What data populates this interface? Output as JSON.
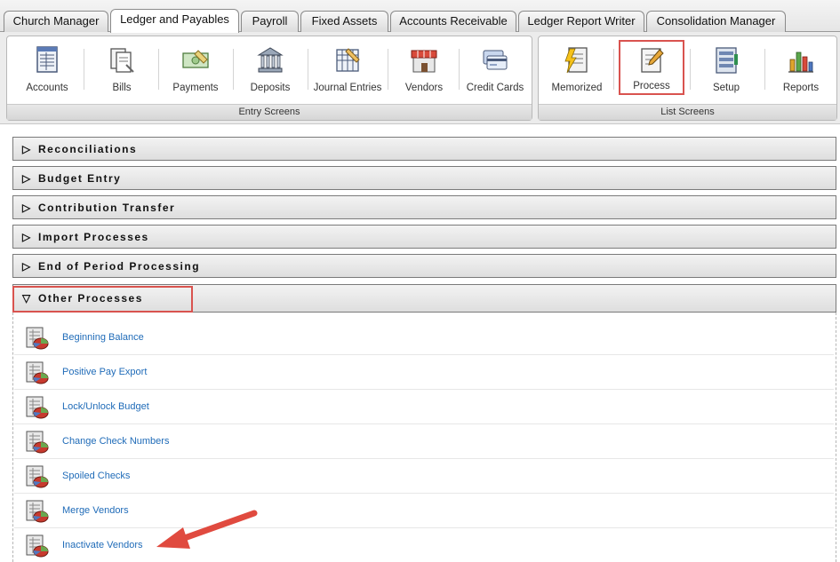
{
  "tabs": [
    {
      "label": "Church Manager"
    },
    {
      "label": "Ledger and Payables"
    },
    {
      "label": "Payroll"
    },
    {
      "label": "Fixed Assets"
    },
    {
      "label": "Accounts Receivable"
    },
    {
      "label": "Ledger Report Writer"
    },
    {
      "label": "Consolidation Manager"
    }
  ],
  "entry_screens": {
    "caption": "Entry Screens",
    "items": [
      {
        "label": "Accounts",
        "icon": "accounts-icon"
      },
      {
        "label": "Bills",
        "icon": "bills-icon"
      },
      {
        "label": "Payments",
        "icon": "payments-icon"
      },
      {
        "label": "Deposits",
        "icon": "bank-icon"
      },
      {
        "label": "Journal Entries",
        "icon": "journal-icon"
      },
      {
        "label": "Vendors",
        "icon": "store-icon"
      },
      {
        "label": "Credit Cards",
        "icon": "credit-card-icon"
      }
    ]
  },
  "list_screens": {
    "caption": "List Screens",
    "items": [
      {
        "label": "Memorized",
        "icon": "memorized-icon"
      },
      {
        "label": "Process",
        "icon": "process-icon",
        "highlighted": true
      },
      {
        "label": "Setup",
        "icon": "setup-icon"
      },
      {
        "label": "Reports",
        "icon": "reports-chart-icon"
      }
    ]
  },
  "sections": [
    {
      "label": "Reconciliations",
      "expanded": false
    },
    {
      "label": "Budget Entry",
      "expanded": false
    },
    {
      "label": "Contribution Transfer",
      "expanded": false
    },
    {
      "label": "Import Processes",
      "expanded": false
    },
    {
      "label": "End of Period Processing",
      "expanded": false
    },
    {
      "label": "Other Processes",
      "expanded": true
    }
  ],
  "other_processes": [
    {
      "label": "Beginning Balance"
    },
    {
      "label": "Positive Pay Export"
    },
    {
      "label": "Lock/Unlock Budget"
    },
    {
      "label": "Change Check Numbers"
    },
    {
      "label": "Spoiled Checks"
    },
    {
      "label": "Merge Vendors"
    },
    {
      "label": "Inactivate Vendors"
    }
  ],
  "glyphs": {
    "collapsed": "▷",
    "expanded": "▽"
  },
  "colors": {
    "highlight": "#d9534f",
    "link": "#1f6bb8",
    "arrow": "#e04a3f"
  }
}
